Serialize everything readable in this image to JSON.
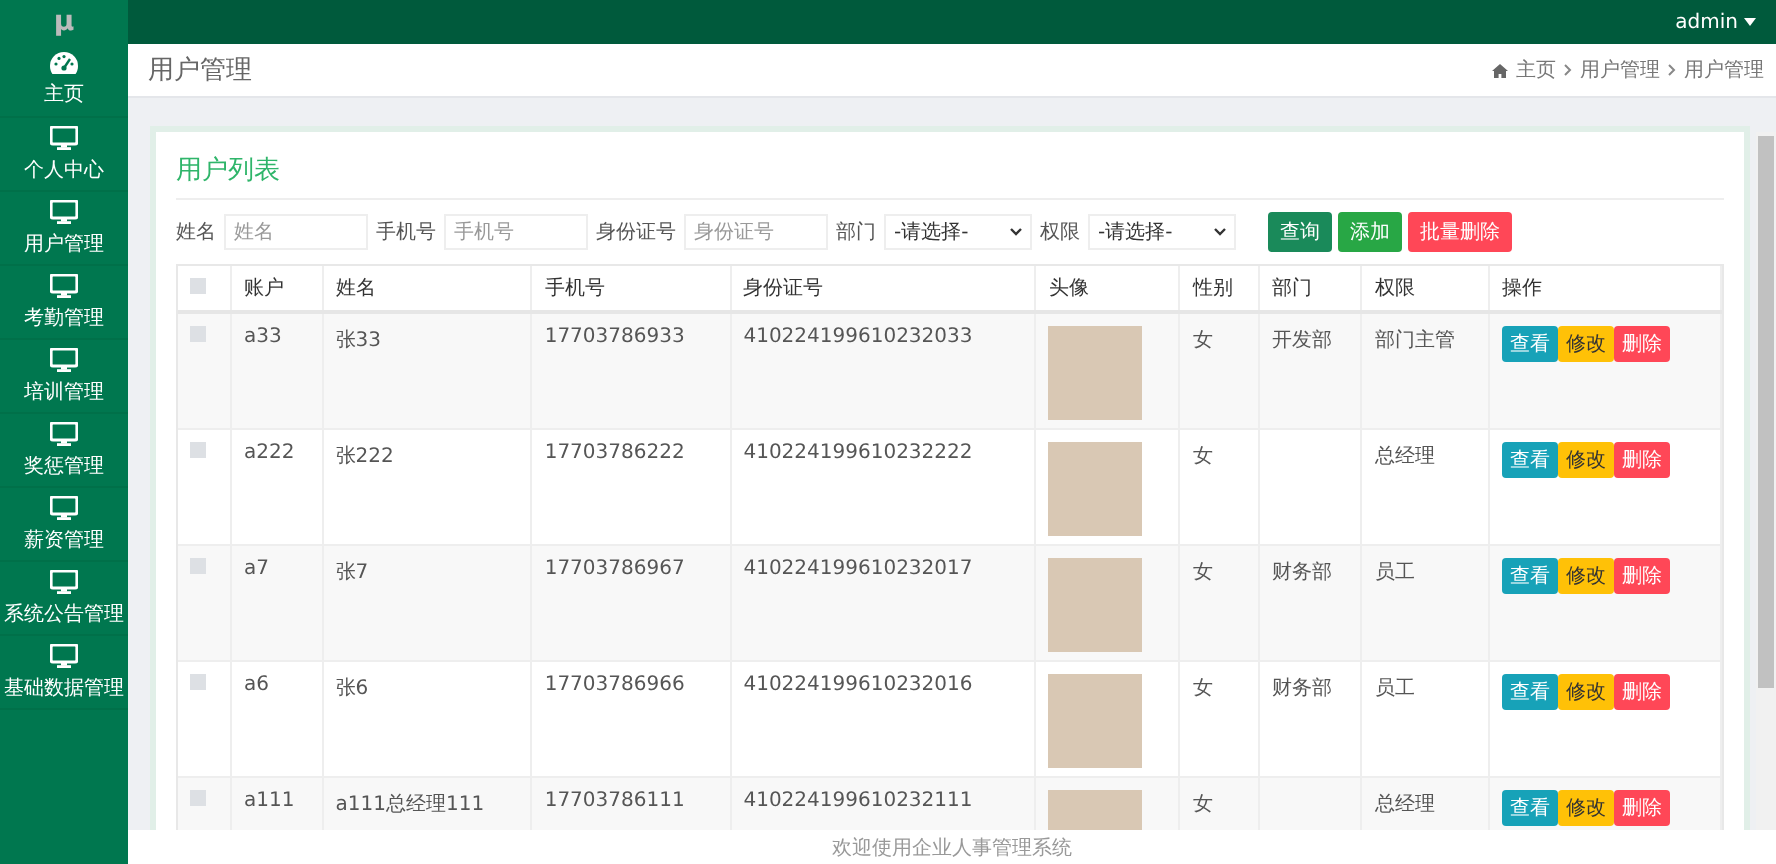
{
  "logo": "μ",
  "user_menu": {
    "label": "admin"
  },
  "sidebar": {
    "items": [
      {
        "label": "主页",
        "kind": "home"
      },
      {
        "label": "个人中心",
        "kind": "module"
      },
      {
        "label": "用户管理",
        "kind": "module"
      },
      {
        "label": "考勤管理",
        "kind": "module"
      },
      {
        "label": "培训管理",
        "kind": "module"
      },
      {
        "label": "奖惩管理",
        "kind": "module"
      },
      {
        "label": "薪资管理",
        "kind": "module"
      },
      {
        "label": "系统公告管理",
        "kind": "module"
      },
      {
        "label": "基础数据管理",
        "kind": "module"
      }
    ]
  },
  "page_title": "用户管理",
  "breadcrumb": [
    "主页",
    "用户管理",
    "用户管理"
  ],
  "card_title": "用户列表",
  "filters": [
    {
      "kind": "input",
      "label": "姓名",
      "placeholder": "姓名"
    },
    {
      "kind": "input",
      "label": "手机号",
      "placeholder": "手机号"
    },
    {
      "kind": "input",
      "label": "身份证号",
      "placeholder": "身份证号"
    },
    {
      "kind": "select",
      "label": "部门",
      "value": "-请选择-"
    },
    {
      "kind": "select",
      "label": "权限",
      "value": "-请选择-"
    }
  ],
  "toolbar_buttons": [
    {
      "label": "查询",
      "kind": "query"
    },
    {
      "label": "添加",
      "kind": "add"
    },
    {
      "label": "批量删除",
      "kind": "delete"
    }
  ],
  "table": {
    "header_checkbox": {
      "checked": false
    },
    "columns": [
      "账户",
      "姓名",
      "手机号",
      "身份证号",
      "头像",
      "性别",
      "部门",
      "权限",
      "操作"
    ],
    "rows": [
      {
        "checked": false,
        "account": "a33",
        "name": "张33",
        "phone": "17703786933",
        "id_number": "410224199610232033",
        "gender": "女",
        "department": "开发部",
        "role": "部门主管",
        "actions": [
          {
            "label": "查看",
            "kind": "view"
          },
          {
            "label": "修改",
            "kind": "edit"
          },
          {
            "label": "删除",
            "kind": "delete"
          }
        ]
      },
      {
        "checked": false,
        "account": "a222",
        "name": "张222",
        "phone": "17703786222",
        "id_number": "410224199610232222",
        "gender": "女",
        "department": "",
        "role": "总经理",
        "actions": [
          {
            "label": "查看",
            "kind": "view"
          },
          {
            "label": "修改",
            "kind": "edit"
          },
          {
            "label": "删除",
            "kind": "delete"
          }
        ]
      },
      {
        "checked": false,
        "account": "a7",
        "name": "张7",
        "phone": "17703786967",
        "id_number": "410224199610232017",
        "gender": "女",
        "department": "财务部",
        "role": "员工",
        "actions": [
          {
            "label": "查看",
            "kind": "view"
          },
          {
            "label": "修改",
            "kind": "edit"
          },
          {
            "label": "删除",
            "kind": "delete"
          }
        ]
      },
      {
        "checked": false,
        "account": "a6",
        "name": "张6",
        "phone": "17703786966",
        "id_number": "410224199610232016",
        "gender": "女",
        "department": "财务部",
        "role": "员工",
        "actions": [
          {
            "label": "查看",
            "kind": "view"
          },
          {
            "label": "修改",
            "kind": "edit"
          },
          {
            "label": "删除",
            "kind": "delete"
          }
        ]
      },
      {
        "checked": false,
        "account": "a111",
        "name": "a111总经理111",
        "phone": "17703786111",
        "id_number": "410224199610232111",
        "gender": "女",
        "department": "",
        "role": "总经理",
        "actions": [
          {
            "label": "查看",
            "kind": "view"
          },
          {
            "label": "修改",
            "kind": "edit"
          },
          {
            "label": "删除",
            "kind": "delete"
          }
        ]
      }
    ]
  },
  "footer": "欢迎使用企业人事管理系统"
}
